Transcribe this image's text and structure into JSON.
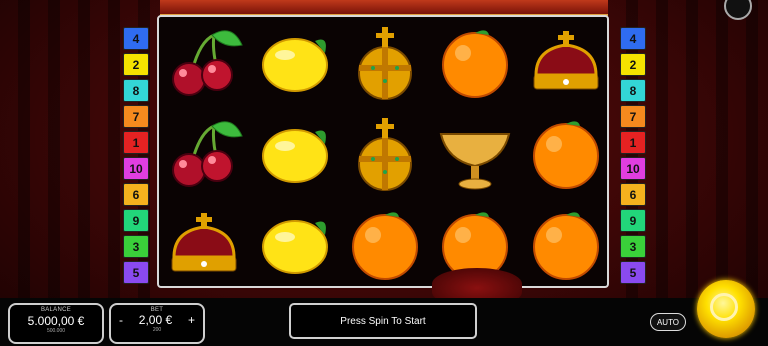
{
  "paylines_left": [
    {
      "n": "4",
      "color": "#2f6cf0"
    },
    {
      "n": "2",
      "color": "#f5e200"
    },
    {
      "n": "8",
      "color": "#33d6d6"
    },
    {
      "n": "7",
      "color": "#f58a1e"
    },
    {
      "n": "1",
      "color": "#e52222"
    },
    {
      "n": "10",
      "color": "#e03ee0"
    },
    {
      "n": "6",
      "color": "#f5b21e"
    },
    {
      "n": "9",
      "color": "#22d67a"
    },
    {
      "n": "3",
      "color": "#3ad03a"
    },
    {
      "n": "5",
      "color": "#8a4af0"
    }
  ],
  "paylines_right": [
    {
      "n": "4",
      "color": "#2f6cf0"
    },
    {
      "n": "2",
      "color": "#f5e200"
    },
    {
      "n": "8",
      "color": "#33d6d6"
    },
    {
      "n": "7",
      "color": "#f58a1e"
    },
    {
      "n": "1",
      "color": "#e52222"
    },
    {
      "n": "10",
      "color": "#e03ee0"
    },
    {
      "n": "6",
      "color": "#f5b21e"
    },
    {
      "n": "9",
      "color": "#22d67a"
    },
    {
      "n": "3",
      "color": "#3ad03a"
    },
    {
      "n": "5",
      "color": "#8a4af0"
    }
  ],
  "reels": [
    [
      "cherry",
      "cherry",
      "crown"
    ],
    [
      "lemon",
      "lemon",
      "lemon"
    ],
    [
      "orb",
      "orb",
      "orange"
    ],
    [
      "orange",
      "chalice",
      "orange"
    ],
    [
      "crown",
      "orange",
      "orange"
    ]
  ],
  "balance": {
    "label": "BALANCE",
    "value": "5.000,00 €",
    "sub": "500.000"
  },
  "bet": {
    "label": "BET",
    "value": "2,00 €",
    "sub": "200",
    "minus": "-",
    "plus": "+"
  },
  "message": "Press Spin To Start",
  "auto_label": "AUTO"
}
